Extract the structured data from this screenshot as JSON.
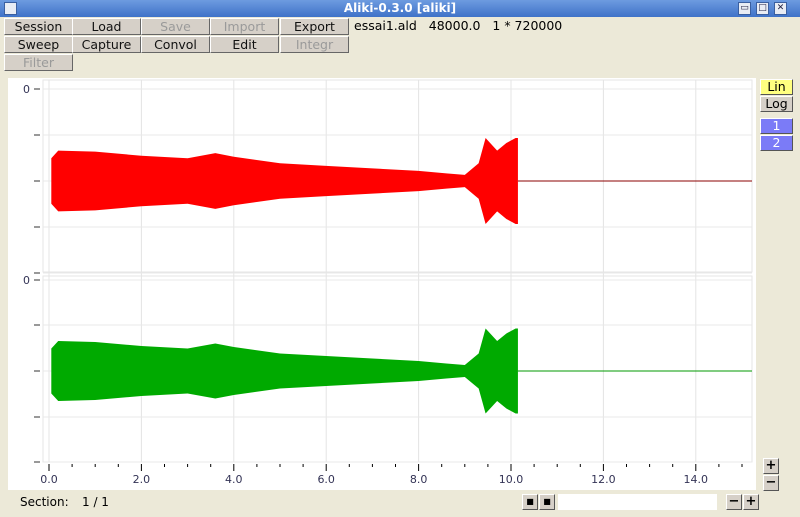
{
  "window": {
    "title": "Aliki-0.3.0  [aliki]",
    "controls": [
      "▭",
      "□",
      "✕"
    ]
  },
  "toolbar": {
    "buttons": [
      {
        "label": "Session",
        "enabled": true
      },
      {
        "label": "Load",
        "enabled": true
      },
      {
        "label": "Save",
        "enabled": false
      },
      {
        "label": "Import",
        "enabled": false
      },
      {
        "label": "Export",
        "enabled": true
      },
      {
        "label": "Sweep",
        "enabled": true
      },
      {
        "label": "Capture",
        "enabled": true
      },
      {
        "label": "Convol",
        "enabled": true
      },
      {
        "label": "Edit",
        "enabled": true
      },
      {
        "label": "Integr",
        "enabled": false
      },
      {
        "label": "Filter",
        "enabled": false
      }
    ]
  },
  "info": {
    "file": "essai1.ald",
    "rate": "48000.0",
    "size": "1 * 720000"
  },
  "side": {
    "lin": "Lin",
    "log": "Log",
    "ch1": "1",
    "ch2": "2",
    "colors": {
      "lin": "#ffff80",
      "log": "#d6d0c8",
      "ch": "#7b7bf7"
    }
  },
  "plot": {
    "x_ticks": [
      "0.0",
      "2.0",
      "4.0",
      "6.0",
      "8.0",
      "10.0",
      "12.0",
      "14.0"
    ],
    "y_label": "0",
    "channels": [
      {
        "color": "#ff0000"
      },
      {
        "color": "#00aa00"
      }
    ],
    "end_time": 10.15,
    "envelope": [
      [
        0.05,
        0.45
      ],
      [
        0.2,
        0.6
      ],
      [
        1,
        0.58
      ],
      [
        2,
        0.5
      ],
      [
        3,
        0.45
      ],
      [
        3.6,
        0.55
      ],
      [
        4,
        0.48
      ],
      [
        5,
        0.35
      ],
      [
        6,
        0.3
      ],
      [
        7,
        0.25
      ],
      [
        8,
        0.2
      ],
      [
        8.6,
        0.15
      ],
      [
        9,
        0.12
      ],
      [
        9.3,
        0.35
      ],
      [
        9.45,
        0.85
      ],
      [
        9.7,
        0.6
      ],
      [
        9.9,
        0.75
      ],
      [
        10.1,
        0.85
      ],
      [
        10.15,
        0.85
      ]
    ]
  },
  "footer": {
    "section_label": "Section:",
    "section_value": "1 / 1",
    "input": "",
    "minus": "−",
    "plus": "+"
  }
}
